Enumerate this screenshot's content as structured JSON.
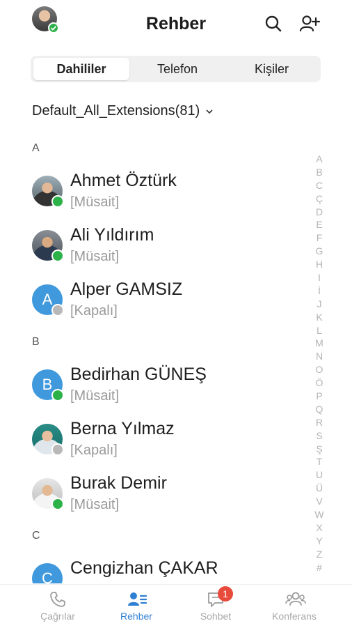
{
  "header": {
    "title": "Rehber"
  },
  "tabs": [
    {
      "label": "Dahililer",
      "active": true
    },
    {
      "label": "Telefon",
      "active": false
    },
    {
      "label": "Kişiler",
      "active": false
    }
  ],
  "group_select": {
    "label": "Default_All_Extensions(81)"
  },
  "sections": [
    {
      "letter": "A"
    },
    {
      "letter": "B"
    },
    {
      "letter": "C"
    }
  ],
  "contacts": [
    {
      "name": "Ahmet Öztürk",
      "status": "[Müsait]",
      "avatar": "photo",
      "presence": "online"
    },
    {
      "name": "Ali Yıldırım",
      "status": "[Müsait]",
      "avatar": "photo",
      "presence": "online"
    },
    {
      "name": "Alper GAMSIZ",
      "status": "[Kapalı]",
      "avatar_initial": "A",
      "presence": "offline"
    },
    {
      "name": "Bedirhan GÜNEŞ",
      "status": "[Müsait]",
      "avatar_initial": "B",
      "presence": "online"
    },
    {
      "name": "Berna Yılmaz",
      "status": "[Kapalı]",
      "avatar": "photo",
      "presence": "offline"
    },
    {
      "name": "Burak Demir",
      "status": "[Müsait]",
      "avatar": "photo",
      "presence": "online"
    },
    {
      "name": "Cengizhan ÇAKAR",
      "status": "",
      "avatar_initial": "C",
      "presence": "unknown"
    }
  ],
  "alphabet_index": [
    "A",
    "B",
    "C",
    "Ç",
    "D",
    "E",
    "F",
    "G",
    "H",
    "I",
    "İ",
    "J",
    "K",
    "L",
    "M",
    "N",
    "O",
    "Ö",
    "P",
    "Q",
    "R",
    "S",
    "Ş",
    "T",
    "U",
    "Ü",
    "V",
    "W",
    "X",
    "Y",
    "Z",
    "#"
  ],
  "bottom_nav": [
    {
      "label": "Çağrılar",
      "icon": "phone-icon",
      "active": false
    },
    {
      "label": "Rehber",
      "icon": "contacts-icon",
      "active": true
    },
    {
      "label": "Sohbet",
      "icon": "chat-icon",
      "active": false,
      "badge": "1"
    },
    {
      "label": "Konferans",
      "icon": "conference-icon",
      "active": false
    }
  ],
  "colors": {
    "accent": "#2f7fd3",
    "online": "#2db24a",
    "offline": "#b8b8b8",
    "avatar_initial_bg": "#3f99dc",
    "badge": "#e84a3b"
  }
}
